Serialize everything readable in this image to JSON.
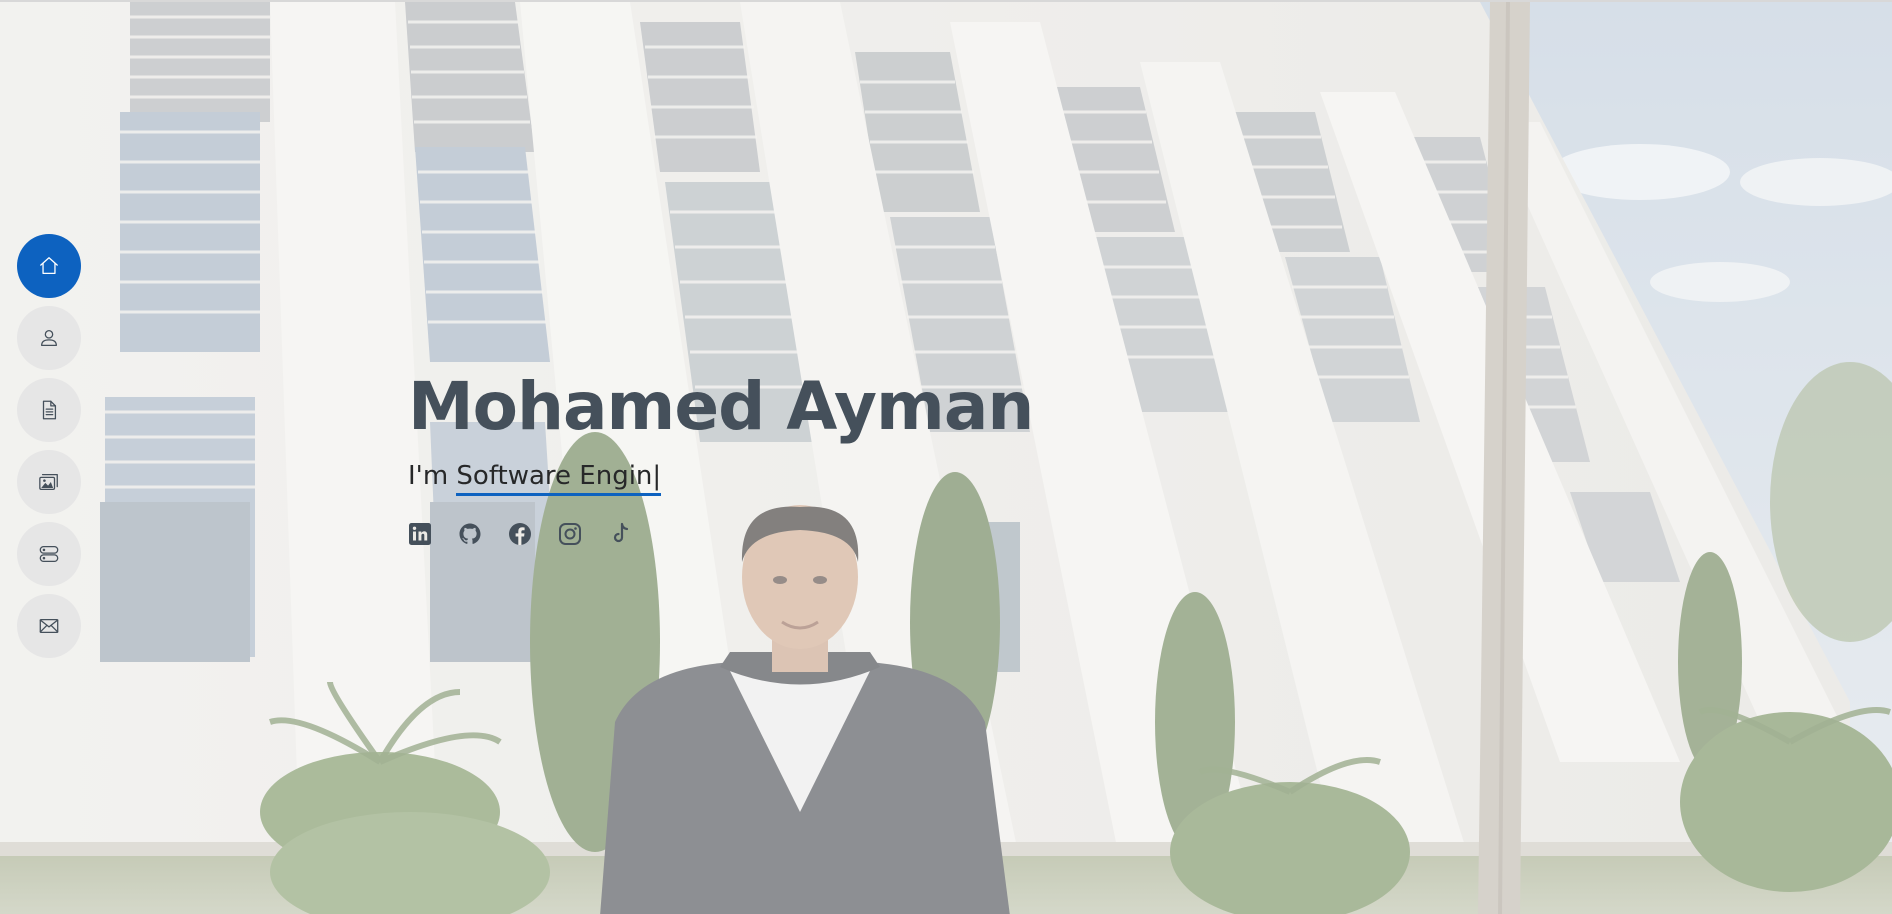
{
  "hero": {
    "name": "Mohamed Ayman",
    "tagline_prefix": "I'm ",
    "typed_text": "Software Engin",
    "cursor": "|",
    "background_image": "photo of a person standing in front of a white modern building with slanted columns and palm trees"
  },
  "side_nav": {
    "items": [
      {
        "id": "home",
        "icon": "home-icon",
        "active": true
      },
      {
        "id": "about",
        "icon": "person-icon",
        "active": false
      },
      {
        "id": "resume",
        "icon": "file-text-icon",
        "active": false
      },
      {
        "id": "portfolio",
        "icon": "images-icon",
        "active": false
      },
      {
        "id": "services",
        "icon": "server-icon",
        "active": false
      },
      {
        "id": "contact",
        "icon": "envelope-icon",
        "active": false
      }
    ]
  },
  "social": {
    "links": [
      {
        "id": "linkedin",
        "icon": "linkedin-icon"
      },
      {
        "id": "github",
        "icon": "github-icon"
      },
      {
        "id": "facebook",
        "icon": "facebook-icon"
      },
      {
        "id": "instagram",
        "icon": "instagram-icon"
      },
      {
        "id": "tiktok",
        "icon": "tiktok-icon"
      }
    ]
  },
  "colors": {
    "accent": "#0d62c0",
    "heading": "#45505b",
    "text": "#272829",
    "nav_bg": "#e6e6e6"
  }
}
